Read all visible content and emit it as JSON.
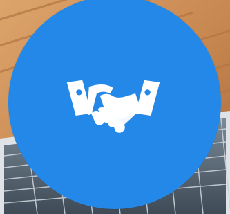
{
  "colors": {
    "badge_fill": "#2488e8",
    "icon_fill": "#ffffff",
    "wood_light": "#d7a06a",
    "wood_dark": "#b9773f",
    "panel_frame": "#c9ced4",
    "panel_cell": "#5c6b79"
  },
  "icons": {
    "center": "handshake-icon"
  }
}
